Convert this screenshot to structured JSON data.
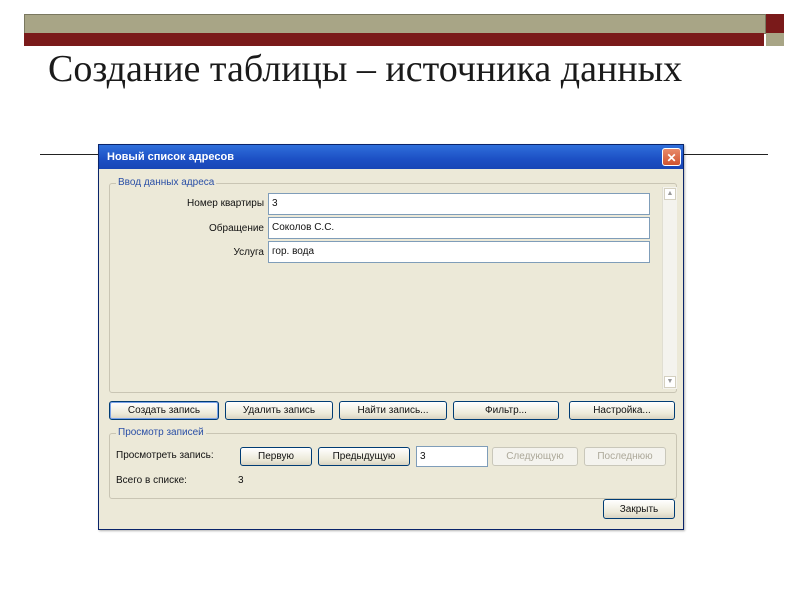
{
  "slide": {
    "title": "Создание таблицы – источника данных"
  },
  "dialog": {
    "title": "Новый список адресов",
    "close_glyph": "✕",
    "entry_group": {
      "legend": "Ввод данных адреса",
      "fields": [
        {
          "label": "Номер квартиры",
          "value": "3"
        },
        {
          "label": "Обращение",
          "value": "Соколов С.С."
        },
        {
          "label": "Услуга",
          "value": "гор. вода"
        }
      ]
    },
    "actions": {
      "create": "Создать запись",
      "delete": "Удалить запись",
      "find": "Найти запись...",
      "filter": "Фильтр...",
      "settings": "Настройка..."
    },
    "view_group": {
      "legend": "Просмотр записей",
      "view_label": "Просмотреть запись:",
      "first": "Первую",
      "previous": "Предыдущую",
      "current_record": "3",
      "next": "Следующую",
      "last": "Последнюю",
      "total_label": "Всего в списке:",
      "total_value": "3"
    },
    "close_button": "Закрыть"
  },
  "colors": {
    "olive_bar": "#a8a586",
    "maroon_bar": "#7a1a1a",
    "titlebar_blue": "#1c4fc4"
  }
}
